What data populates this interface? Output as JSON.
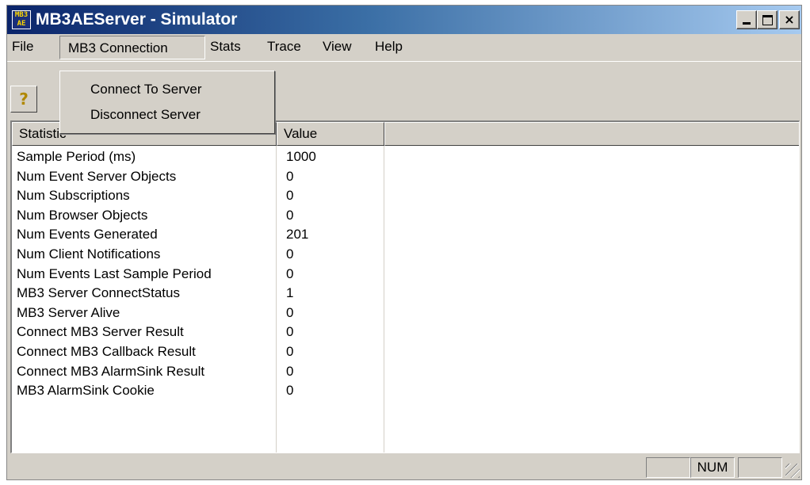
{
  "window": {
    "title": "MB3AEServer - Simulator",
    "icon_text": "MB3 AE",
    "controls": [
      "minimize",
      "maximize",
      "close"
    ],
    "close_glyph": "×"
  },
  "menu": {
    "items": [
      "File",
      "MB3 Connection",
      "Stats",
      "Trace",
      "View",
      "Help"
    ],
    "open_menu": "MB3 Connection",
    "dropdown": [
      "Connect To Server",
      "Disconnect Server"
    ]
  },
  "toolbar": {
    "help_glyph": "?"
  },
  "table": {
    "columns": [
      "Statistic",
      "Value"
    ],
    "rows": [
      [
        "Sample Period (ms)",
        "1000"
      ],
      [
        "Num Event Server Objects",
        "0"
      ],
      [
        "Num Subscriptions",
        "0"
      ],
      [
        "Num Browser Objects",
        "0"
      ],
      [
        "Num Events Generated",
        "201"
      ],
      [
        "Num Client Notifications",
        "0"
      ],
      [
        "Num Events Last Sample Period",
        "0"
      ],
      [
        "MB3 Server ConnectStatus",
        "1"
      ],
      [
        "MB3 Server Alive",
        "0"
      ],
      [
        "Connect MB3 Server Result",
        "0"
      ],
      [
        "Connect MB3 Callback Result",
        "0"
      ],
      [
        "Connect MB3 AlarmSink Result",
        "0"
      ],
      [
        "MB3 AlarmSink Cookie",
        "0"
      ]
    ]
  },
  "statusbar": {
    "panels": [
      "",
      "NUM",
      ""
    ]
  }
}
